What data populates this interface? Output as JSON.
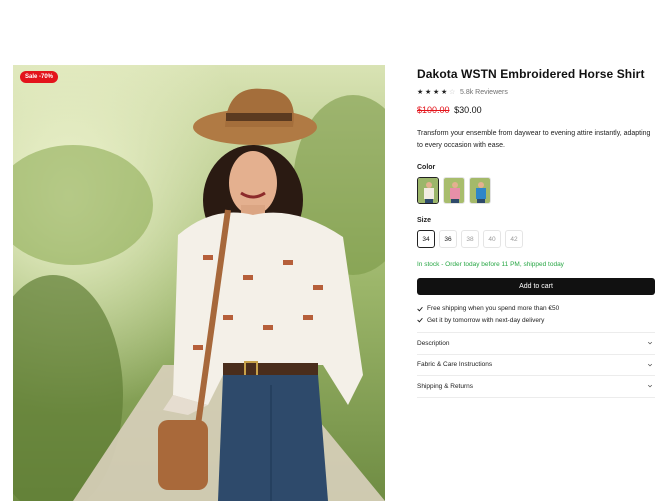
{
  "product": {
    "sale_badge": "Sale -70%",
    "title": "Dakota WSTN Embroidered Horse Shirt",
    "rating": 3.5,
    "reviewers": "5.8k Reviewers",
    "old_price": "$100.00",
    "new_price": "$30.00",
    "description": "Transform your ensemble from daywear to evening attire instantly, adapting to every occasion with ease."
  },
  "color": {
    "label": "Color",
    "options": [
      {
        "name": "white",
        "shirt_color": "#f2ece2"
      },
      {
        "name": "pink",
        "shirt_color": "#e78fa8"
      },
      {
        "name": "blue",
        "shirt_color": "#2f86c9"
      }
    ]
  },
  "size": {
    "label": "Size",
    "options": [
      "34",
      "36",
      "38",
      "40",
      "42"
    ],
    "selected": "34"
  },
  "stock_text": "In stock - Order today before 11 PM, shipped today",
  "add_to_cart": "Add to cart",
  "perks": [
    "Free shipping when you spend more than €50",
    "Get it by tomorrow with next-day delivery"
  ],
  "accordion": [
    "Description",
    "Fabric & Care Instructions",
    "Shipping & Returns"
  ],
  "colors": {
    "sale_red": "#e3141b",
    "stock_green": "#28a745",
    "button_black": "#111111"
  }
}
